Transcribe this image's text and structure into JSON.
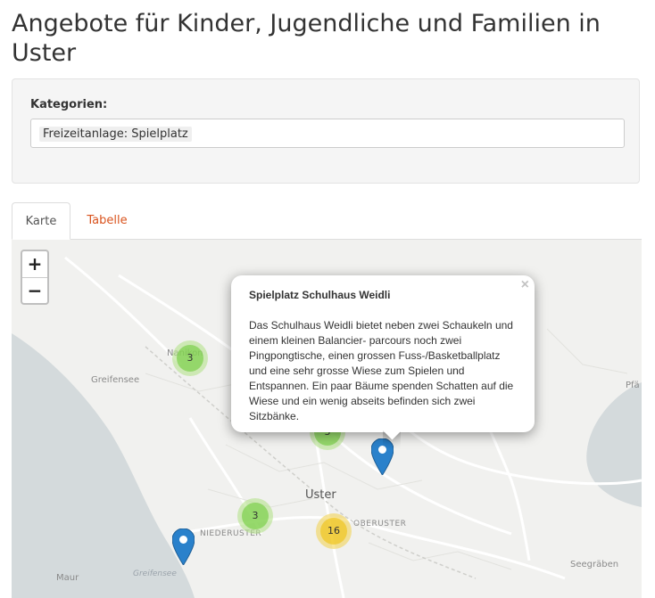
{
  "page": {
    "title": "Angebote für Kinder, Jugendliche und Familien in Uster"
  },
  "filter": {
    "label": "Kategorien:",
    "selected_tag": "Freizeitanlage: Spielplatz"
  },
  "tabs": [
    {
      "label": "Karte",
      "active": true
    },
    {
      "label": "Tabelle",
      "active": false
    }
  ],
  "map": {
    "zoom_in_label": "+",
    "zoom_out_label": "−",
    "place_labels": {
      "greifensee": "Greifensee",
      "uster": "Uster",
      "niederuster": "NIEDERUSTER",
      "oberuster": "OBERUSTER",
      "maur": "Maur",
      "seegraeben": "Seegräben",
      "pfaeffikon": "Pfä",
      "nanikon": "Nanikon",
      "lake": "Greifensee"
    },
    "clusters": [
      {
        "name": "cluster-nanikon",
        "count": "3",
        "color": "green"
      },
      {
        "name": "cluster-center",
        "count": "3",
        "color": "green"
      },
      {
        "name": "cluster-niederuster",
        "count": "3",
        "color": "green"
      },
      {
        "name": "cluster-oberuster",
        "count": "16",
        "color": "yellow"
      }
    ],
    "popup": {
      "title": "Spielplatz Schulhaus Weidli",
      "text": "Das Schulhaus Weidli bietet neben zwei Schaukeln und einem kleinen Balancier- parcours noch zwei Pingpongtische, einen grossen Fuss-/Basketballplatz und eine sehr grosse Wiese zum Spielen und Entspannen. Ein paar Bäume spenden Schatten auf die Wiese und ein wenig abseits befinden sich zwei Sitzbänke.",
      "close_label": "×"
    },
    "colors": {
      "marker": "#2a81cb",
      "tab_link": "#d9531e",
      "lake": "#d4dadc"
    }
  }
}
